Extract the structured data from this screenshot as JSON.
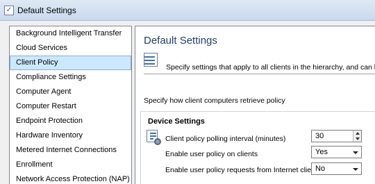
{
  "window": {
    "title": "Default Settings",
    "icon": "checkbox-icon"
  },
  "sidebar": {
    "items": [
      {
        "label": "Background Intelligent Transfer"
      },
      {
        "label": "Cloud Services"
      },
      {
        "label": "Client Policy",
        "selected": true
      },
      {
        "label": "Compliance Settings"
      },
      {
        "label": "Computer Agent"
      },
      {
        "label": "Computer Restart"
      },
      {
        "label": "Endpoint Protection"
      },
      {
        "label": "Hardware Inventory"
      },
      {
        "label": "Metered Internet Connections"
      },
      {
        "label": "Enrollment"
      },
      {
        "label": "Network Access Protection (NAP)"
      }
    ]
  },
  "main": {
    "title": "Default Settings",
    "intro": "Specify settings that apply to all clients in the hierarchy, and can be modi",
    "retrieve": "Specify how client computers retrieve policy",
    "section": {
      "title": "Device Settings",
      "rows": [
        {
          "label": "Client policy polling interval (minutes)",
          "value": "30"
        },
        {
          "label": "Enable user policy on clients",
          "value": "Yes"
        },
        {
          "label": "Enable user policy requests from Internet clients",
          "value": "No"
        }
      ]
    }
  },
  "colors": {
    "selection": "#cce8ff",
    "title": "#1e3f6e",
    "titlebar": "#dfe9f5"
  }
}
